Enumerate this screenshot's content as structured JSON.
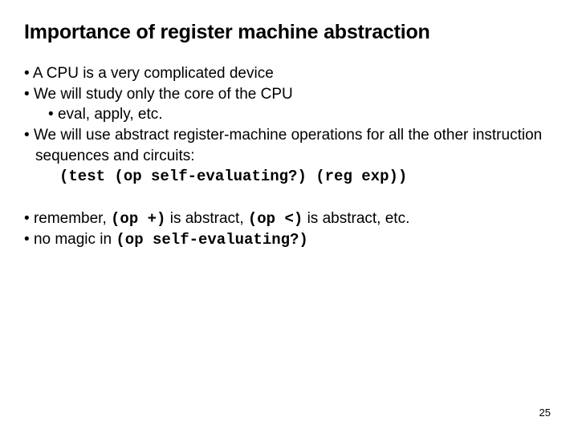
{
  "title": "Importance of register machine abstraction",
  "blockA": {
    "b1": "A CPU is a very complicated device",
    "b2": "We will study only the core of the CPU",
    "b2a": "eval, apply, etc.",
    "b3": "We will use abstract register-machine operations for all the other instruction sequences and circuits:",
    "b3code": "(test (op self-evaluating?) (reg exp))"
  },
  "blockB": {
    "b4_pre": "remember, ",
    "b4_c1": "(op +)",
    "b4_mid": " is abstract, ",
    "b4_c2": "(op <)",
    "b4_post": " is abstract, etc.",
    "b5_pre": "no magic in ",
    "b5_c1": "(op self-evaluating?)"
  },
  "pageNumber": "25"
}
